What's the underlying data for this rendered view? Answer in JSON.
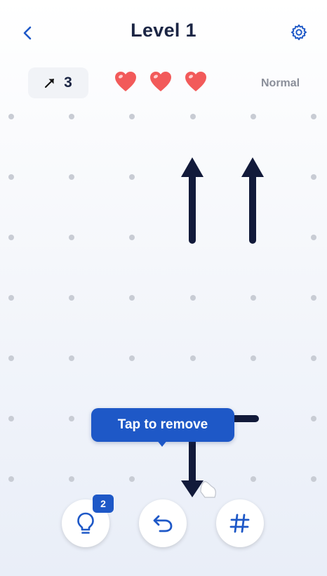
{
  "header": {
    "title": "Level 1",
    "back_icon": "chevron-left-icon",
    "settings_icon": "gear-icon"
  },
  "status": {
    "arrows_left": "3",
    "arrow_icon": "diagonal-arrow-icon",
    "lives": 3,
    "heart_icon": "heart-icon",
    "difficulty": "Normal"
  },
  "board": {
    "columns": 6,
    "rows": 7,
    "arrows": [
      {
        "id": "up-arrow-left",
        "direction": "up"
      },
      {
        "id": "up-arrow-right",
        "direction": "up"
      },
      {
        "id": "bottom-bent-arrow",
        "direction": "down"
      }
    ]
  },
  "tooltip": {
    "text": "Tap to remove"
  },
  "controls": {
    "hint_icon": "lightbulb-icon",
    "hint_count": "2",
    "undo_icon": "undo-icon",
    "grid_icon": "hash-icon"
  },
  "colors": {
    "accent": "#1e58c7",
    "arrow": "#121a3a",
    "heart": "#f25a5a",
    "dot": "#c8ccd4"
  }
}
